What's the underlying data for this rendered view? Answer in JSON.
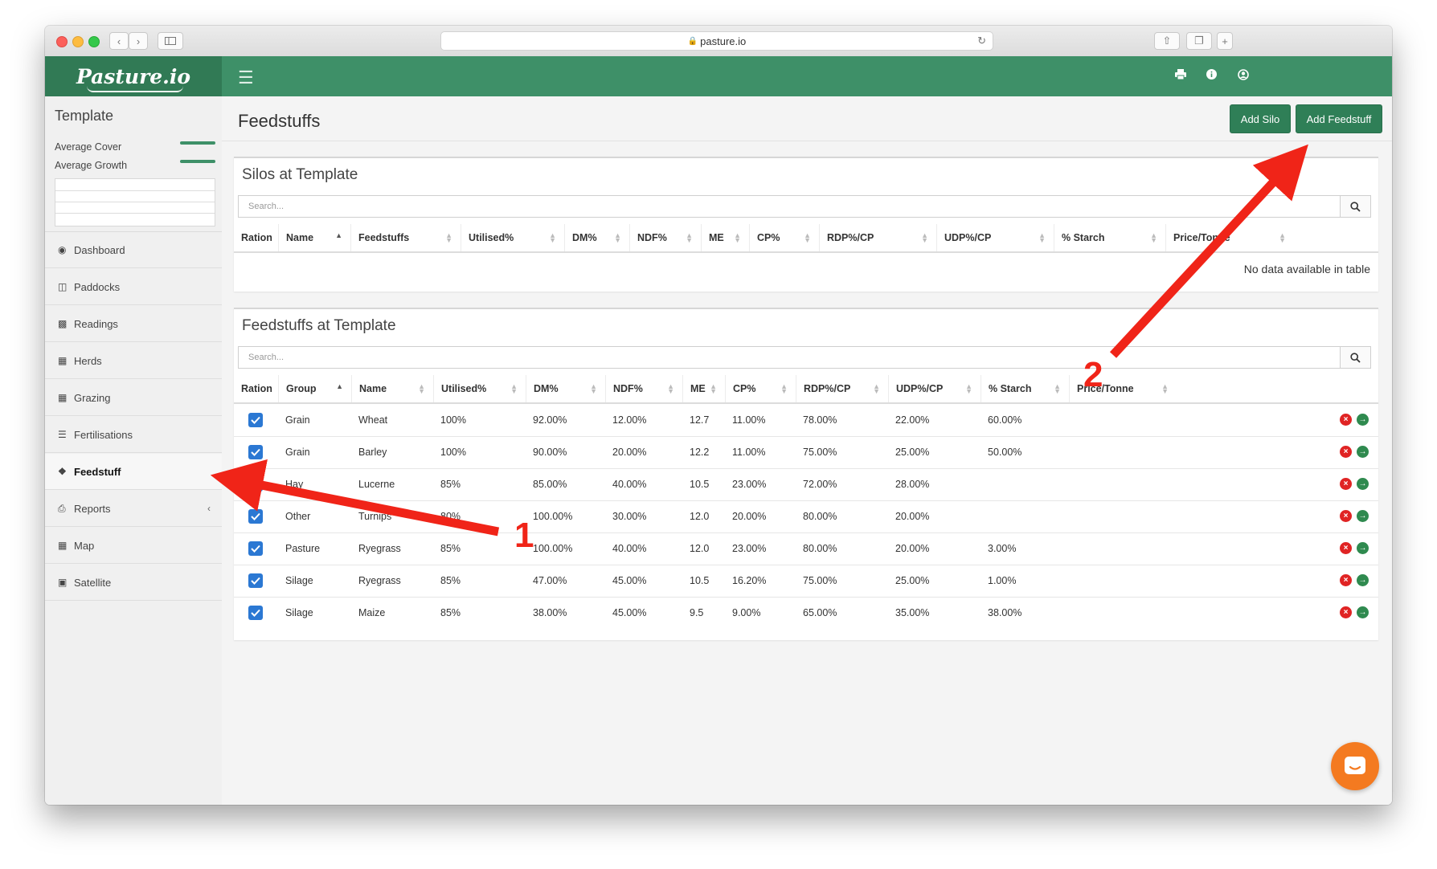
{
  "browser": {
    "url": "pasture.io"
  },
  "app": {
    "logo": "Pasture.io"
  },
  "sidebar": {
    "farm_name": "Template",
    "metrics": [
      {
        "label": "Average Cover"
      },
      {
        "label": "Average Growth"
      }
    ],
    "items": [
      {
        "label": "Dashboard",
        "icon": "dashboard-icon"
      },
      {
        "label": "Paddocks",
        "icon": "paddocks-icon"
      },
      {
        "label": "Readings",
        "icon": "bar-chart-icon"
      },
      {
        "label": "Herds",
        "icon": "grid-icon"
      },
      {
        "label": "Grazing",
        "icon": "calendar-icon"
      },
      {
        "label": "Fertilisations",
        "icon": "list-icon"
      },
      {
        "label": "Feedstuff",
        "icon": "cubes-icon"
      },
      {
        "label": "Reports",
        "icon": "print-icon"
      },
      {
        "label": "Map",
        "icon": "map-icon"
      },
      {
        "label": "Satellite",
        "icon": "image-icon"
      }
    ]
  },
  "header": {
    "title": "Feedstuffs",
    "add_silo": "Add Silo",
    "add_feedstuff": "Add Feedstuff"
  },
  "silos": {
    "title": "Silos at Template",
    "search_placeholder": "Search...",
    "columns": [
      "Ration",
      "Name",
      "Feedstuffs",
      "Utilised%",
      "DM%",
      "NDF%",
      "ME",
      "CP%",
      "RDP%/CP",
      "UDP%/CP",
      "% Starch",
      "Price/Tonne"
    ],
    "empty": "No data available in table"
  },
  "feedstuffs": {
    "title": "Feedstuffs at Template",
    "search_placeholder": "Search...",
    "columns": [
      "Ration",
      "Group",
      "Name",
      "Utilised%",
      "DM%",
      "NDF%",
      "ME",
      "CP%",
      "RDP%/CP",
      "UDP%/CP",
      "% Starch",
      "Price/Tonne"
    ],
    "rows": [
      {
        "group": "Grain",
        "name": "Wheat",
        "utilised": "100%",
        "dm": "92.00%",
        "ndf": "12.00%",
        "me": "12.7",
        "cp": "11.00%",
        "rdp": "78.00%",
        "udp": "22.00%",
        "starch": "60.00%",
        "price": ""
      },
      {
        "group": "Grain",
        "name": "Barley",
        "utilised": "100%",
        "dm": "90.00%",
        "ndf": "20.00%",
        "me": "12.2",
        "cp": "11.00%",
        "rdp": "75.00%",
        "udp": "25.00%",
        "starch": "50.00%",
        "price": ""
      },
      {
        "group": "Hay",
        "name": "Lucerne",
        "utilised": "85%",
        "dm": "85.00%",
        "ndf": "40.00%",
        "me": "10.5",
        "cp": "23.00%",
        "rdp": "72.00%",
        "udp": "28.00%",
        "starch": "",
        "price": ""
      },
      {
        "group": "Other",
        "name": "Turnips",
        "utilised": "80%",
        "dm": "100.00%",
        "ndf": "30.00%",
        "me": "12.0",
        "cp": "20.00%",
        "rdp": "80.00%",
        "udp": "20.00%",
        "starch": "",
        "price": ""
      },
      {
        "group": "Pasture",
        "name": "Ryegrass",
        "utilised": "85%",
        "dm": "100.00%",
        "ndf": "40.00%",
        "me": "12.0",
        "cp": "23.00%",
        "rdp": "80.00%",
        "udp": "20.00%",
        "starch": "3.00%",
        "price": ""
      },
      {
        "group": "Silage",
        "name": "Ryegrass",
        "utilised": "85%",
        "dm": "47.00%",
        "ndf": "45.00%",
        "me": "10.5",
        "cp": "16.20%",
        "rdp": "75.00%",
        "udp": "25.00%",
        "starch": "1.00%",
        "price": ""
      },
      {
        "group": "Silage",
        "name": "Maize",
        "utilised": "85%",
        "dm": "38.00%",
        "ndf": "45.00%",
        "me": "9.5",
        "cp": "9.00%",
        "rdp": "65.00%",
        "udp": "35.00%",
        "starch": "38.00%",
        "price": ""
      }
    ]
  },
  "annotations": {
    "label_1": "1",
    "label_2": "2",
    "color": "#f02418"
  },
  "colors": {
    "brand_green": "#3e9068",
    "button_green": "#2f7f57",
    "checkbox_blue": "#2b78d3",
    "chat_orange": "#f47a20"
  }
}
